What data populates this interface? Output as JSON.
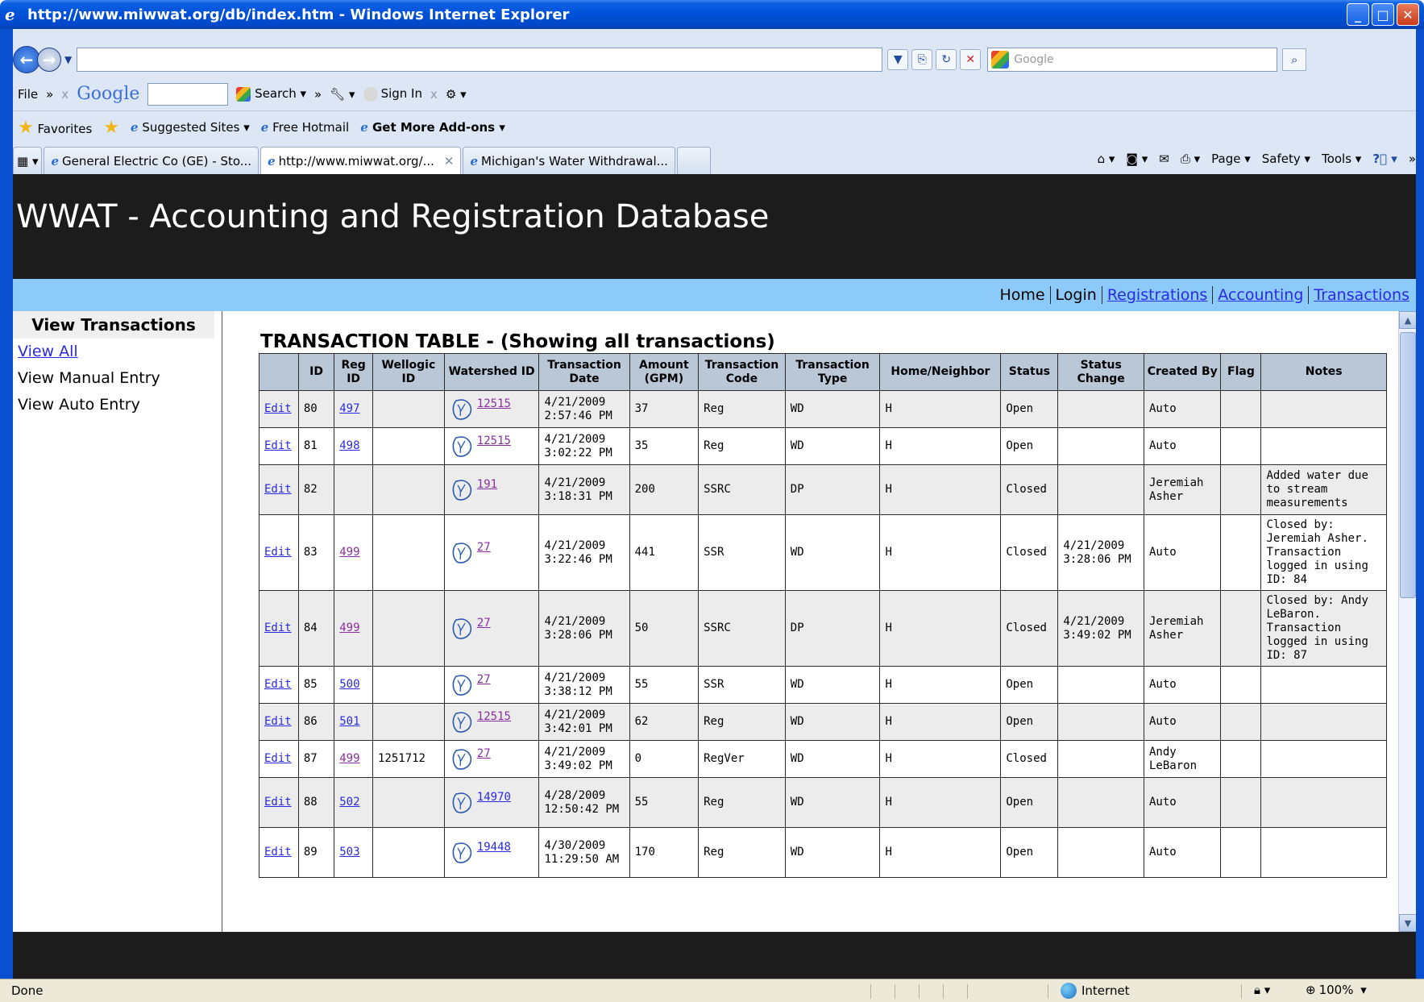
{
  "window": {
    "title": "http://www.miwwat.org/db/index.htm - Windows Internet Explorer"
  },
  "address_bar": {
    "url_value": "",
    "search_placeholder": "Google"
  },
  "toolbar": {
    "file_label": "File",
    "google_label": "Google",
    "search_label": "Search",
    "signin_label": "Sign In"
  },
  "favorites_bar": {
    "favorites_label": "Favorites",
    "suggested_sites": "Suggested Sites",
    "free_hotmail": "Free Hotmail",
    "get_addons": "Get More Add-ons"
  },
  "tabs": [
    {
      "label": "General Electric Co (GE) - Sto..."
    },
    {
      "label": "http://www.miwwat.org/..."
    },
    {
      "label": "Michigan's Water Withdrawal..."
    }
  ],
  "command_bar": {
    "page": "Page",
    "safety": "Safety",
    "tools": "Tools"
  },
  "site": {
    "header_title": "WWAT - Accounting and Registration Database",
    "nav": [
      {
        "label": "Home",
        "link": false
      },
      {
        "label": "Login",
        "link": false
      },
      {
        "label": "Registrations",
        "link": true
      },
      {
        "label": "Accounting",
        "link": true
      },
      {
        "label": "Transactions",
        "link": true
      }
    ]
  },
  "sidebar": {
    "title": "View Transactions",
    "items": [
      {
        "label": "View All",
        "link": true
      },
      {
        "label": "View Manual Entry",
        "link": false
      },
      {
        "label": "View Auto Entry",
        "link": false
      }
    ]
  },
  "table": {
    "title": "TRANSACTION TABLE - (Showing all transactions)",
    "headers": [
      "",
      "ID",
      "Reg ID",
      "Wellogic ID",
      "Watershed ID",
      "Transaction Date",
      "Amount (GPM)",
      "Transaction Code",
      "Transaction Type",
      "Home/Neighbor",
      "Status",
      "Status Change",
      "Created By",
      "Flag",
      "Notes"
    ],
    "edit_label": "Edit",
    "rows": [
      {
        "id": "80",
        "reg_id": "497",
        "reg_visited": false,
        "wellogic_id": "",
        "watershed_id": "12515",
        "ws_visited": true,
        "date": "4/21/2009 2:57:46 PM",
        "amount": "37",
        "code": "Reg",
        "type": "WD",
        "home": "H",
        "status": "Open",
        "status_change": "",
        "created_by": "Auto",
        "flag": "",
        "notes": ""
      },
      {
        "id": "81",
        "reg_id": "498",
        "reg_visited": false,
        "wellogic_id": "",
        "watershed_id": "12515",
        "ws_visited": true,
        "date": "4/21/2009 3:02:22 PM",
        "amount": "35",
        "code": "Reg",
        "type": "WD",
        "home": "H",
        "status": "Open",
        "status_change": "",
        "created_by": "Auto",
        "flag": "",
        "notes": ""
      },
      {
        "id": "82",
        "reg_id": "",
        "reg_visited": false,
        "wellogic_id": "",
        "watershed_id": "191",
        "ws_visited": true,
        "date": "4/21/2009 3:18:31 PM",
        "amount": "200",
        "code": "SSRC",
        "type": "DP",
        "home": "H",
        "status": "Closed",
        "status_change": "",
        "created_by": "Jeremiah Asher",
        "flag": "",
        "notes": "Added water due to stream measurements"
      },
      {
        "id": "83",
        "reg_id": "499",
        "reg_visited": true,
        "wellogic_id": "",
        "watershed_id": "27",
        "ws_visited": true,
        "date": "4/21/2009 3:22:46 PM",
        "amount": "441",
        "code": "SSR",
        "type": "WD",
        "home": "H",
        "status": "Closed",
        "status_change": "4/21/2009 3:28:06 PM",
        "created_by": "Auto",
        "flag": "",
        "notes": "Closed by: Jeremiah Asher. Transaction logged in using ID: 84"
      },
      {
        "id": "84",
        "reg_id": "499",
        "reg_visited": true,
        "wellogic_id": "",
        "watershed_id": "27",
        "ws_visited": true,
        "date": "4/21/2009 3:28:06 PM",
        "amount": "50",
        "code": "SSRC",
        "type": "DP",
        "home": "H",
        "status": "Closed",
        "status_change": "4/21/2009 3:49:02 PM",
        "created_by": "Jeremiah Asher",
        "flag": "",
        "notes": "Closed by: Andy LeBaron. Transaction logged in using ID: 87"
      },
      {
        "id": "85",
        "reg_id": "500",
        "reg_visited": false,
        "wellogic_id": "",
        "watershed_id": "27",
        "ws_visited": true,
        "date": "4/21/2009 3:38:12 PM",
        "amount": "55",
        "code": "SSR",
        "type": "WD",
        "home": "H",
        "status": "Open",
        "status_change": "",
        "created_by": "Auto",
        "flag": "",
        "notes": ""
      },
      {
        "id": "86",
        "reg_id": "501",
        "reg_visited": false,
        "wellogic_id": "",
        "watershed_id": "12515",
        "ws_visited": true,
        "date": "4/21/2009 3:42:01 PM",
        "amount": "62",
        "code": "Reg",
        "type": "WD",
        "home": "H",
        "status": "Open",
        "status_change": "",
        "created_by": "Auto",
        "flag": "",
        "notes": ""
      },
      {
        "id": "87",
        "reg_id": "499",
        "reg_visited": true,
        "wellogic_id": "1251712",
        "watershed_id": "27",
        "ws_visited": true,
        "date": "4/21/2009 3:49:02 PM",
        "amount": "0",
        "code": "RegVer",
        "type": "WD",
        "home": "H",
        "status": "Closed",
        "status_change": "",
        "created_by": "Andy LeBaron",
        "flag": "",
        "notes": ""
      },
      {
        "id": "88",
        "reg_id": "502",
        "reg_visited": false,
        "wellogic_id": "",
        "watershed_id": "14970",
        "ws_visited": false,
        "date": "4/28/2009 12:50:42 PM",
        "amount": "55",
        "code": "Reg",
        "type": "WD",
        "home": "H",
        "status": "Open",
        "status_change": "",
        "created_by": "Auto",
        "flag": "",
        "notes": ""
      },
      {
        "id": "89",
        "reg_id": "503",
        "reg_visited": false,
        "wellogic_id": "",
        "watershed_id": "19448",
        "ws_visited": false,
        "date": "4/30/2009 11:29:50 AM",
        "amount": "170",
        "code": "Reg",
        "type": "WD",
        "home": "H",
        "status": "Open",
        "status_change": "",
        "created_by": "Auto",
        "flag": "",
        "notes": ""
      }
    ]
  },
  "status_bar": {
    "status_text": "Done",
    "zone": "Internet",
    "zoom": "100%"
  }
}
